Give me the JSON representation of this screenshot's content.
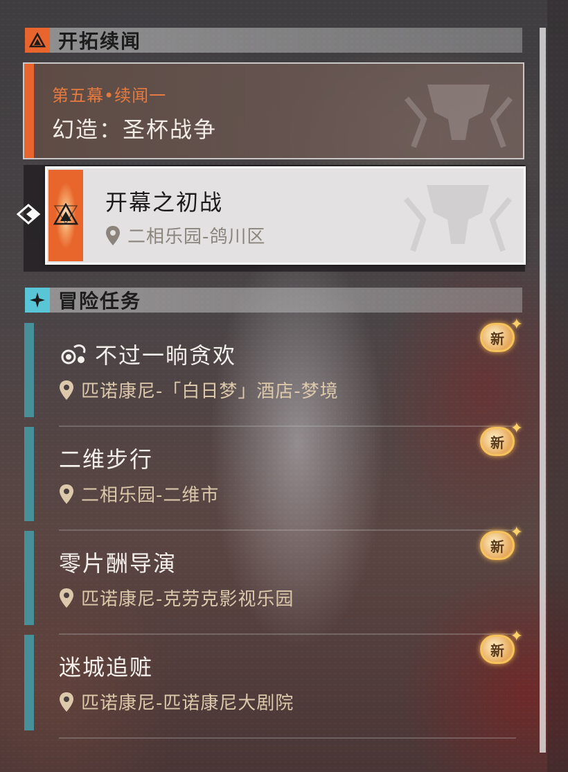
{
  "sections": {
    "trailblaze": {
      "title": "开拓续闻"
    },
    "adventure": {
      "title": "冒险任务"
    }
  },
  "story": {
    "chapter": "第五幕•续闻一",
    "title": "幻造：圣杯战争"
  },
  "selected_mission": {
    "title": "开幕之初战",
    "location": "二相乐园-鸽川区"
  },
  "quests": [
    {
      "title": "不过一晌贪欢",
      "location": "匹诺康尼-「白日梦」酒店-梦境",
      "badge": "新",
      "has_icon": true
    },
    {
      "title": "二维步行",
      "location": "二相乐园-二维市",
      "badge": "新"
    },
    {
      "title": "零片酬导演",
      "location": "匹诺康尼-克劳克影视乐园",
      "badge": "新"
    },
    {
      "title": "迷城追赃",
      "location": "匹诺康尼-匹诺康尼大剧院",
      "badge": "新"
    }
  ],
  "colors": {
    "accent_orange": "#e8652d",
    "accent_cyan": "#59c6d8",
    "quest_bar": "#47909a",
    "location_text": "#dcc8aa"
  }
}
